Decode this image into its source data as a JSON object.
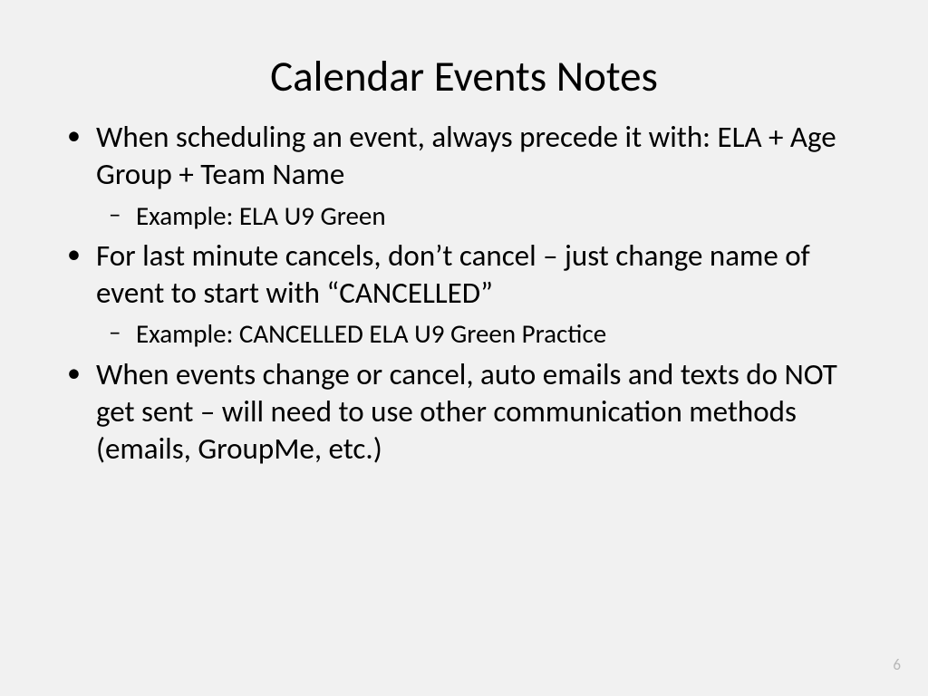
{
  "slide": {
    "title": "Calendar Events Notes",
    "bullets": [
      {
        "text": "When scheduling an event, always precede it with:  ELA + Age Group + Team Name",
        "sub": [
          "Example:  ELA U9 Green"
        ]
      },
      {
        "text": "For last minute cancels, don’t cancel – just change name of event to start with “CANCELLED”",
        "sub": [
          "Example:  CANCELLED ELA U9 Green Practice"
        ]
      },
      {
        "text": "When events change or cancel, auto emails and texts do NOT get sent – will need to use other communication methods (emails, GroupMe, etc.)",
        "sub": []
      }
    ],
    "page_number": "6"
  }
}
